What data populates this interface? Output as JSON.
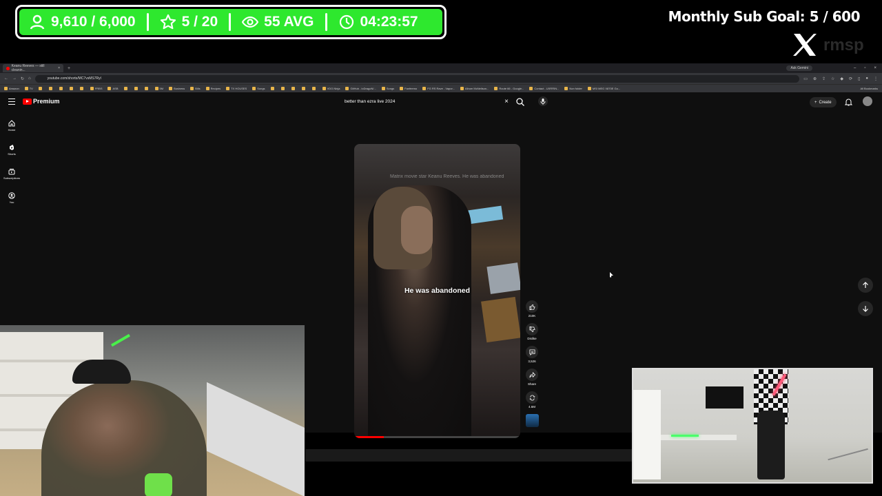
{
  "overlay": {
    "stats": [
      {
        "icon": "user-icon",
        "value": "9,610 / 6,000"
      },
      {
        "icon": "star-icon",
        "value": "5 / 20"
      },
      {
        "icon": "eye-icon",
        "value": "55 AVG"
      },
      {
        "icon": "timer-icon",
        "value": "04:23:57"
      }
    ],
    "sub_goal": "Monthly Sub Goal:  5 / 600",
    "x_handle": "rmsp",
    "colors": {
      "stats_bg": "#2ee82e"
    }
  },
  "browser": {
    "tab_title": "Keanu Reeves — still cleanin...",
    "ask_gemini": "Ask Gemini",
    "url": "youtube.com/shorts/MC7vsMS7Ryl",
    "bookmarks": [
      "Amazon",
      "TV",
      "",
      "",
      "",
      "",
      "",
      "FRBS",
      "ASB",
      "",
      "",
      "",
      "5M",
      "Business",
      "Bills",
      "Recipes",
      "TX HOUSES",
      "Songs",
      "",
      "",
      "",
      "",
      "",
      "VDO.Ninja",
      "GitHub - loDragoN/...",
      "Songs",
      "Fanfeemo",
      "FG RS Rave - Vapor...",
      "Album McNeilson...",
      "Route 66 - Google...",
      "Contact - UXRRIN...",
      "Non folder",
      "MSI MEG X870E Go..."
    ],
    "all_bookmarks": "All Bookmarks"
  },
  "youtube": {
    "logo": "Premium",
    "search_value": "better than ezra live 2024",
    "create_label": "Create",
    "sidebar": [
      {
        "icon": "home-icon",
        "label": "Home"
      },
      {
        "icon": "shorts-icon",
        "label": "Shorts"
      },
      {
        "icon": "subscriptions-icon",
        "label": "Subscriptions"
      },
      {
        "icon": "you-icon",
        "label": "You"
      }
    ],
    "video": {
      "top_caption": "Matrix movie star Keanu Reeves. He was abandoned",
      "caption": "He was abandoned",
      "progress": 0.18
    },
    "actions": [
      {
        "icon": "like-icon",
        "label": "210K"
      },
      {
        "icon": "dislike-icon",
        "label": "Dislike"
      },
      {
        "icon": "comment-icon",
        "label": "3,526"
      },
      {
        "icon": "share-icon",
        "label": "Share"
      },
      {
        "icon": "remix-icon",
        "label": "4.6M"
      }
    ]
  }
}
